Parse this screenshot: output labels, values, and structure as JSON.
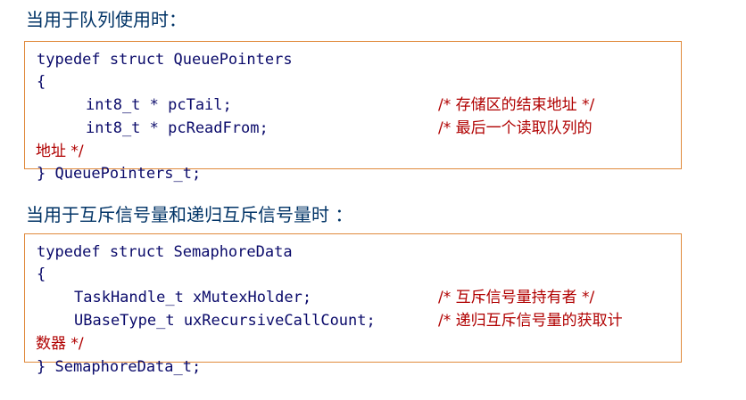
{
  "sections": [
    {
      "heading": "当用于队列使用时：",
      "code": {
        "line1": "typedef struct QueuePointers",
        "open_brace": "{",
        "field1": "int8_t * pcTail;",
        "field1_comment": "/* 存储区的结束地址 */",
        "field2": "int8_t * pcReadFrom;",
        "field2_comment": "/* 最后一个读取队列的",
        "field2_comment_cont": "地址 */",
        "close": "} QueuePointers_t;"
      }
    },
    {
      "heading": "当用于互斥信号量和递归互斥信号量时 ：",
      "code": {
        "line1": "typedef struct SemaphoreData",
        "open_brace": "{",
        "field1": "TaskHandle_t xMutexHolder;",
        "field1_comment": "/* 互斥信号量持有者 */",
        "field2": "UBaseType_t uxRecursiveCallCount;",
        "field2_comment": "/* 递归互斥信号量的获取计",
        "field2_comment_cont": "数器 */",
        "close": "} SemaphoreData_t;"
      }
    }
  ],
  "colors": {
    "heading": "#003366",
    "code": "#0a0a6a",
    "comment": "#b00000",
    "box_border": "#e08a3c"
  }
}
